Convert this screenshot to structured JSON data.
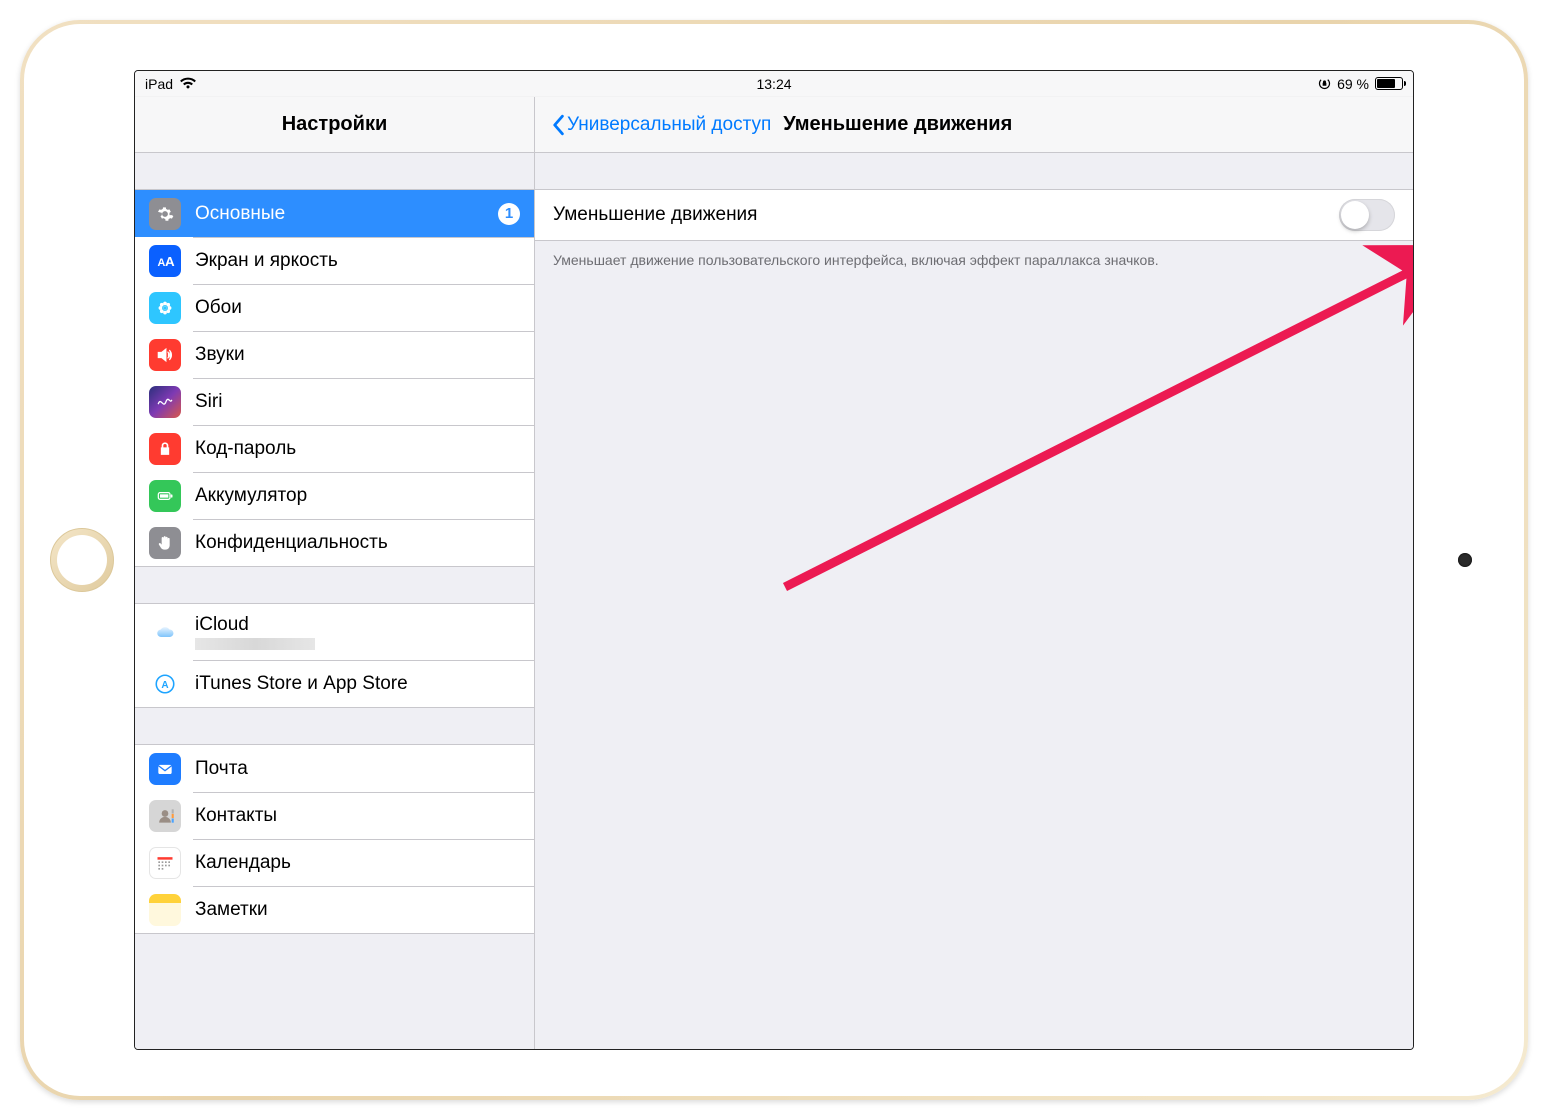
{
  "statusbar": {
    "device": "iPad",
    "time": "13:24",
    "battery_pct": "69 %"
  },
  "sidebar": {
    "title": "Настройки",
    "groups": [
      {
        "items": [
          {
            "key": "general",
            "label": "Основные",
            "badge": "1",
            "selected": true
          },
          {
            "key": "display",
            "label": "Экран и яркость"
          },
          {
            "key": "wallpaper",
            "label": "Обои"
          },
          {
            "key": "sounds",
            "label": "Звуки"
          },
          {
            "key": "siri",
            "label": "Siri"
          },
          {
            "key": "passcode",
            "label": "Код-пароль"
          },
          {
            "key": "battery",
            "label": "Аккумулятор"
          },
          {
            "key": "privacy",
            "label": "Конфиденциальность"
          }
        ]
      },
      {
        "items": [
          {
            "key": "icloud",
            "label": "iCloud",
            "sub_censored": true
          },
          {
            "key": "store",
            "label": "iTunes Store и App Store"
          }
        ]
      },
      {
        "items": [
          {
            "key": "mail",
            "label": "Почта"
          },
          {
            "key": "contacts",
            "label": "Контакты"
          },
          {
            "key": "calendar",
            "label": "Календарь"
          },
          {
            "key": "notes",
            "label": "Заметки"
          }
        ]
      }
    ]
  },
  "detail": {
    "back_label": "Универсальный доступ",
    "title": "Уменьшение движения",
    "toggle_label": "Уменьшение движения",
    "toggle_on": false,
    "footer": "Уменьшает движение пользовательского интерфейса, включая эффект параллакса значков."
  },
  "colors": {
    "accent": "#007aff",
    "selected": "#2d8eff",
    "arrow": "#ec1a52"
  }
}
